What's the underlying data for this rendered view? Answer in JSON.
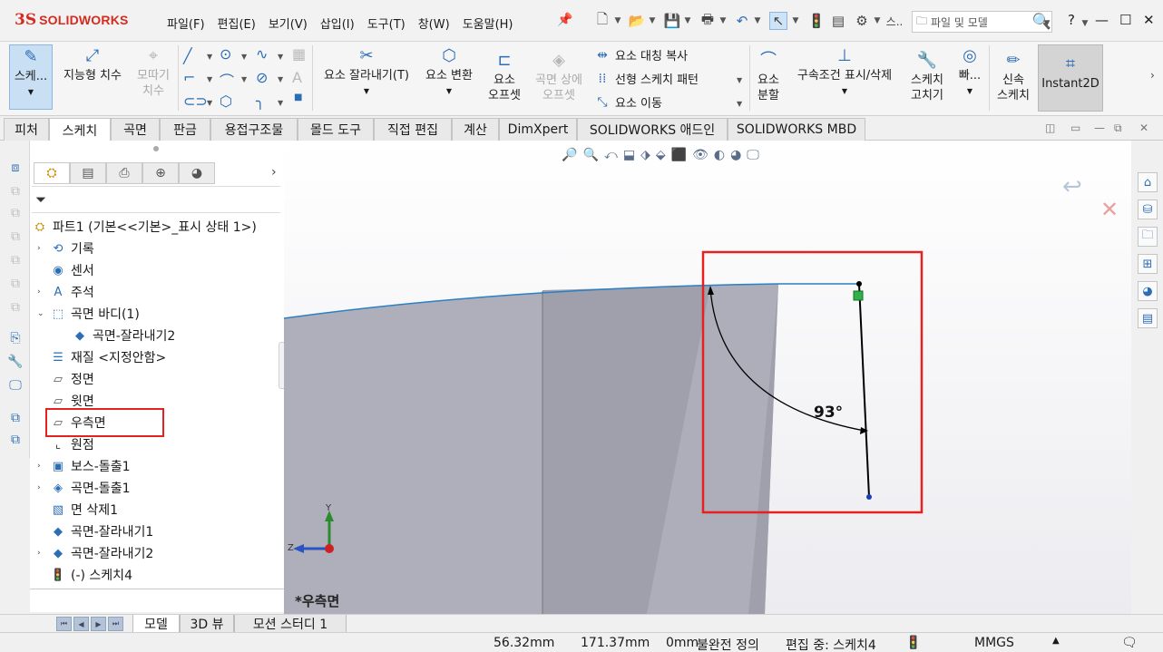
{
  "app": {
    "brand": "SOLIDWORKS",
    "brand_prefix": "3S"
  },
  "menu": [
    "파일(F)",
    "편집(E)",
    "보기(V)",
    "삽입(I)",
    "도구(T)",
    "창(W)",
    "도움말(H)"
  ],
  "search": {
    "placeholder": "파일 및 모델"
  },
  "commands": {
    "sketch": "스케...",
    "smart_dim": "지능형 치수",
    "trim_line1": "모따기",
    "trim_line2": "치수",
    "trim_entities": "요소 잘라내기(T)",
    "convert": "요소 변환",
    "offset_line1": "요소",
    "offset_line2": "오프셋",
    "offset_surf_line1": "곡면 상에",
    "offset_surf_line2": "오프셋",
    "mirror": "요소 대칭 복사",
    "linear_pattern": "선형 스케치 패턴",
    "move": "요소 이동",
    "split_line1": "요소",
    "split_line2": "분할",
    "relations": "구속조건 표시/삭제",
    "repair_line1": "스케치",
    "repair_line2": "고치기",
    "quick": "빠...",
    "rapid_line1": "신속",
    "rapid_line2": "스케치",
    "instant2d": "Instant2D"
  },
  "tabs": [
    "피처",
    "스케치",
    "곡면",
    "판금",
    "용접구조물",
    "몰드 도구",
    "직접 편집",
    "계산",
    "DimXpert",
    "SOLIDWORKS 애드인",
    "SOLIDWORKS MBD"
  ],
  "active_tab": "스케치",
  "tree": {
    "root": "파트1  (기본<<기본>_표시 상태 1>)",
    "items": [
      "기록",
      "센서",
      "주석",
      "곡면 바디(1)",
      "곡면-잘라내기2",
      "재질 <지정안함>",
      "정면",
      "윗면",
      "우측면",
      "원점",
      "보스-돌출1",
      "곡면-돌출1",
      "면 삭제1",
      "곡면-잘라내기1",
      "곡면-잘라내기2",
      "(-) 스케치4"
    ]
  },
  "viewport": {
    "view_name": "*우측면",
    "angle_dim": "93°",
    "axis_y": "Y",
    "axis_z": "Z",
    "colors": {
      "highlight": "#e52121",
      "sketch_line": "#2b7fc4",
      "surface": "#a8a9b4"
    }
  },
  "bottom_tabs": [
    "모델",
    "3D 뷰",
    "모션 스터디 1"
  ],
  "status": {
    "x": "56.32mm",
    "y": "171.37mm",
    "z": "0mm",
    "definition": "불완전 정의",
    "editing": "편집 중: 스케치4",
    "units": "MMGS"
  }
}
